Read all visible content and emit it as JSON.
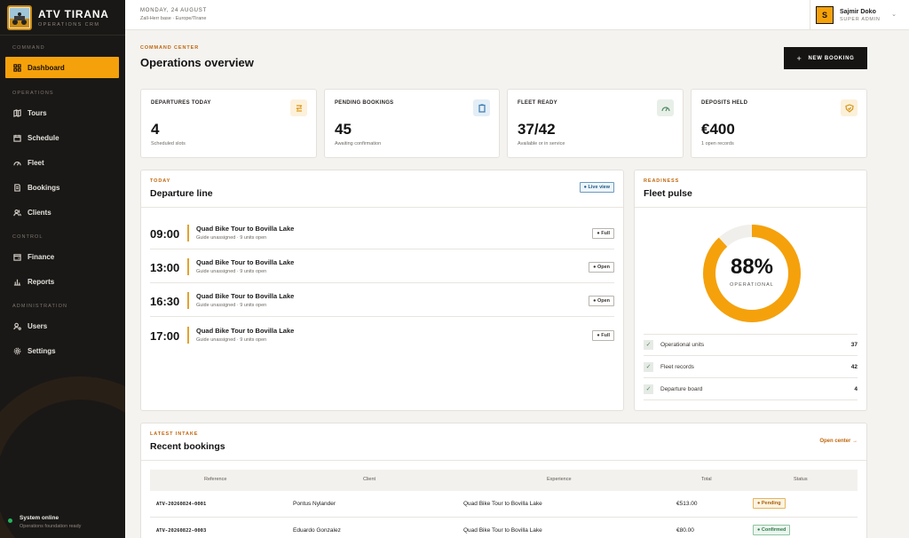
{
  "brand": {
    "name": "ATV TIRANA",
    "subtitle": "OPERATIONS CRM"
  },
  "nav": {
    "sections": {
      "command": "COMMAND",
      "operations": "OPERATIONS",
      "control": "CONTROL",
      "administration": "ADMINISTRATION"
    },
    "items": [
      "Dashboard",
      "Tours",
      "Schedule",
      "Fleet",
      "Bookings",
      "Clients",
      "Finance",
      "Reports",
      "Users",
      "Settings"
    ],
    "active": "Dashboard"
  },
  "status": {
    "title": "System online",
    "subtitle": "Operations foundation ready"
  },
  "topbar": {
    "date": "MONDAY, 24 AUGUST",
    "base": "Zall-Herr base · Europe/Tirane"
  },
  "user": {
    "initial": "S",
    "name": "Sajmir Doko",
    "role": "SUPER ADMIN"
  },
  "header": {
    "kicker": "COMMAND CENTER",
    "title": "Operations overview",
    "new_booking_label": "NEW BOOKING"
  },
  "stats": [
    {
      "label": "DEPARTURES TODAY",
      "value": "4",
      "sub": "Scheduled slots",
      "icon": "route-icon",
      "color": "#f0a020"
    },
    {
      "label": "PENDING BOOKINGS",
      "value": "45",
      "sub": "Awaiting confirmation",
      "icon": "clipboard-icon",
      "color": "#3a7bb0"
    },
    {
      "label": "FLEET READY",
      "value": "37/42",
      "sub": "Available or in service",
      "icon": "gauge-icon",
      "color": "#4f8a5f"
    },
    {
      "label": "DEPOSITS HELD",
      "value": "€400",
      "sub": "1 open records",
      "icon": "shield-icon",
      "color": "#d4961a"
    }
  ],
  "departures": {
    "kicker": "TODAY",
    "title": "Departure line",
    "live_label": "Live view",
    "rows": [
      {
        "time": "09:00",
        "title": "Quad Bike Tour to Bovilla Lake",
        "sub": "Guide unassigned · 9 units open",
        "status": "Full"
      },
      {
        "time": "13:00",
        "title": "Quad Bike Tour to Bovilla Lake",
        "sub": "Guide unassigned · 9 units open",
        "status": "Open"
      },
      {
        "time": "16:30",
        "title": "Quad Bike Tour to Bovilla Lake",
        "sub": "Guide unassigned · 9 units open",
        "status": "Open"
      },
      {
        "time": "17:00",
        "title": "Quad Bike Tour to Bovilla Lake",
        "sub": "Guide unassigned · 9 units open",
        "status": "Full"
      }
    ]
  },
  "fleet": {
    "kicker": "READINESS",
    "title": "Fleet pulse",
    "percent_label": "88%",
    "percent_value": 0.88,
    "gauge_caption": "OPERATIONAL",
    "rows": [
      {
        "label": "Operational units",
        "value": "37"
      },
      {
        "label": "Fleet records",
        "value": "42"
      },
      {
        "label": "Departure board",
        "value": "4"
      }
    ],
    "colors": {
      "ring": "#f5a10b",
      "track": "#f1efeb"
    }
  },
  "bookings": {
    "kicker": "LATEST INTAKE",
    "title": "Recent bookings",
    "open_center_label": "Open center →",
    "columns": [
      "Reference",
      "Client",
      "Experience",
      "Total",
      "Status"
    ],
    "rows": [
      {
        "ref": "ATV-20260824-0001",
        "client": "Pontus Nylander",
        "experience": "Quad Bike Tour to Bovilla Lake",
        "total": "€513.00",
        "status": "Pending"
      },
      {
        "ref": "ATV-20260822-0003",
        "client": "Eduardo Gonzalez",
        "experience": "Quad Bike Tour to Bovilla Lake",
        "total": "€80.00",
        "status": "Confirmed"
      }
    ]
  }
}
